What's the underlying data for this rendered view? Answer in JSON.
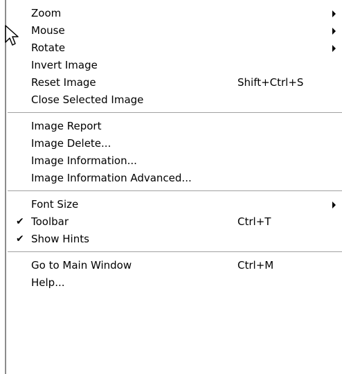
{
  "menu": {
    "groups": [
      {
        "items": [
          {
            "label": "Zoom",
            "shortcut": "",
            "submenu": true,
            "checked": false
          },
          {
            "label": "Mouse",
            "shortcut": "",
            "submenu": true,
            "checked": false
          },
          {
            "label": "Rotate",
            "shortcut": "",
            "submenu": true,
            "checked": false
          },
          {
            "label": "Invert Image",
            "shortcut": "",
            "submenu": false,
            "checked": false
          },
          {
            "label": "Reset Image",
            "shortcut": "Shift+Ctrl+S",
            "submenu": false,
            "checked": false
          },
          {
            "label": "Close Selected Image",
            "shortcut": "",
            "submenu": false,
            "checked": false
          }
        ]
      },
      {
        "items": [
          {
            "label": "Image Report",
            "shortcut": "",
            "submenu": false,
            "checked": false
          },
          {
            "label": "Image Delete...",
            "shortcut": "",
            "submenu": false,
            "checked": false
          },
          {
            "label": "Image Information...",
            "shortcut": "",
            "submenu": false,
            "checked": false
          },
          {
            "label": "Image Information Advanced...",
            "shortcut": "",
            "submenu": false,
            "checked": false
          }
        ]
      },
      {
        "items": [
          {
            "label": "Font Size",
            "shortcut": "",
            "submenu": true,
            "checked": false
          },
          {
            "label": "Toolbar",
            "shortcut": "Ctrl+T",
            "submenu": false,
            "checked": true
          },
          {
            "label": "Show Hints",
            "shortcut": "",
            "submenu": false,
            "checked": true
          }
        ]
      },
      {
        "items": [
          {
            "label": "Go to Main Window",
            "shortcut": "Ctrl+M",
            "submenu": false,
            "checked": false
          },
          {
            "label": "Help...",
            "shortcut": "",
            "submenu": false,
            "checked": false
          }
        ]
      }
    ]
  },
  "icons": {
    "check": "check-icon",
    "submenu_arrow": "chevron-right-icon",
    "cursor": "mouse-pointer-icon"
  },
  "check_glyph": "✔"
}
